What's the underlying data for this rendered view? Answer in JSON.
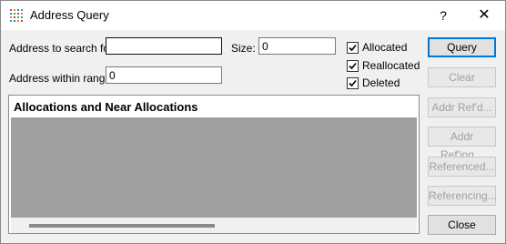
{
  "window": {
    "title": "Address Query",
    "help_label": "?",
    "close_label": "✕"
  },
  "form": {
    "address_label": "Address to search for:",
    "address_value": "",
    "size_label": "Size:",
    "size_value": "0",
    "range_label": "Address within range:",
    "range_value": "0"
  },
  "checkboxes": [
    {
      "label": "Allocated",
      "checked": true
    },
    {
      "label": "Reallocated",
      "checked": true
    },
    {
      "label": "Deleted",
      "checked": true
    }
  ],
  "buttons": {
    "query": "Query",
    "clear": "Clear",
    "addr_refd": "Addr Ref'd...",
    "addr_refing": "Addr Ref'ing...",
    "referenced": "Referenced...",
    "referencing": "Referencing...",
    "close": "Close"
  },
  "list": {
    "header": "Allocations and Near Allocations"
  }
}
